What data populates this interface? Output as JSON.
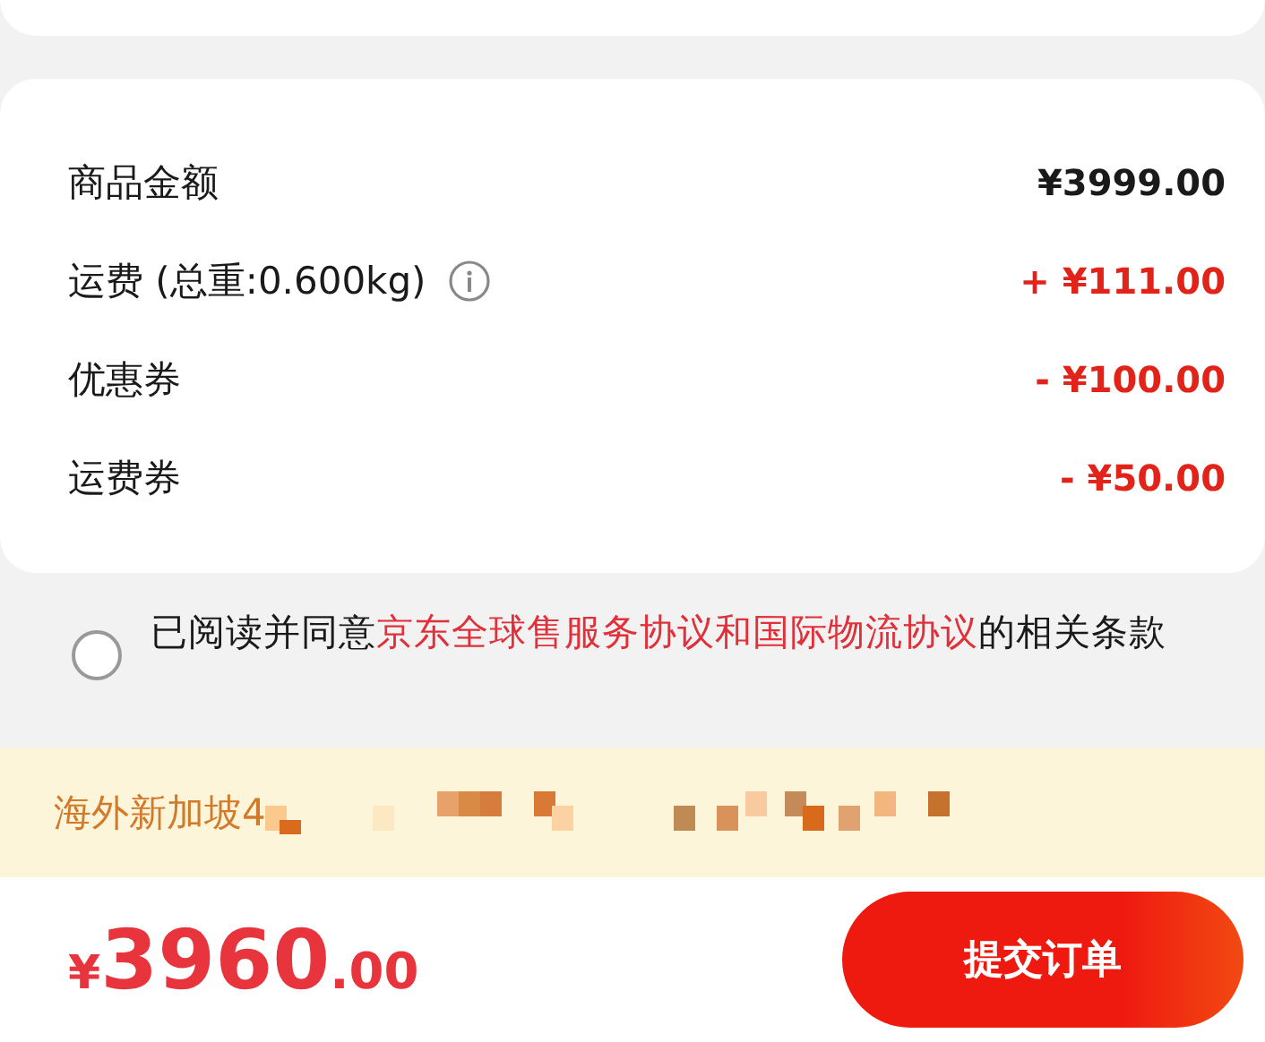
{
  "summary": {
    "rows": [
      {
        "label": "商品金额",
        "value": "¥3999.00",
        "kind": "plain",
        "info": false
      },
      {
        "label": "运费 (总重:0.600kg)",
        "value": "+ ¥111.00",
        "kind": "highlight",
        "info": true
      },
      {
        "label": "优惠券",
        "value": "- ¥100.00",
        "kind": "highlight",
        "info": false
      },
      {
        "label": "运费券",
        "value": "- ¥50.00",
        "kind": "highlight",
        "info": false
      }
    ]
  },
  "agreement": {
    "checked": false,
    "prefix": "已阅读并同意",
    "link": "京东全球售服务协议和国际物流协议",
    "suffix": "的相关条款"
  },
  "address": {
    "text": "海外新加坡4"
  },
  "footer": {
    "total": {
      "currency": "¥",
      "integer": "3960",
      "decimal": ".00"
    },
    "submit": "提交订单"
  }
}
